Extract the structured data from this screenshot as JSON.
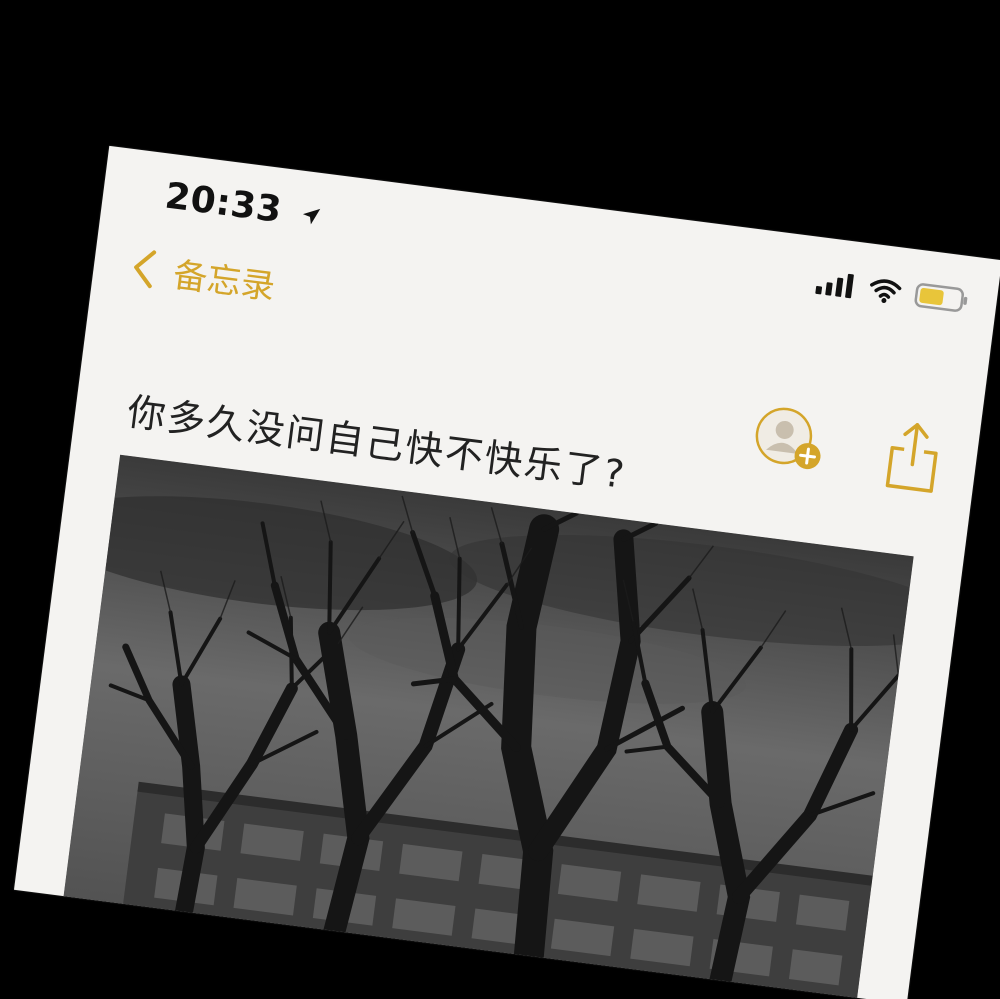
{
  "status_bar": {
    "time": "20:33",
    "location_icon": "location-arrow-icon",
    "signal_icon": "cellular-signal-icon",
    "wifi_icon": "wifi-icon",
    "battery_icon": "battery-icon",
    "battery_level": 0.6
  },
  "nav": {
    "back_label": "备忘录",
    "back_icon": "chevron-left-icon"
  },
  "toolbar": {
    "add_person_icon": "add-person-icon",
    "share_icon": "share-icon"
  },
  "note": {
    "text": "你多久没问自己快不快乐了?"
  },
  "colors": {
    "accent": "#d4a52a",
    "background": "#f4f3f1",
    "outer": "#000000",
    "text": "#222222"
  }
}
